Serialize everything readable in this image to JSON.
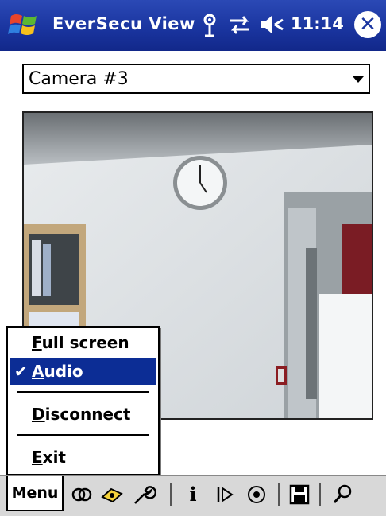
{
  "titlebar": {
    "app_title": "EverSecu View",
    "time": "11:14",
    "icons": [
      "windows-start-icon",
      "signal-antenna-icon",
      "connectivity-icon",
      "volume-icon",
      "close-icon"
    ],
    "close_glyph": "✕"
  },
  "camera_select": {
    "value": "Camera #3"
  },
  "popup_menu": {
    "items": [
      {
        "label": "Full screen",
        "checked": false,
        "selected": false
      },
      {
        "label": "Audio",
        "checked": true,
        "selected": true
      },
      {
        "label": "Disconnect",
        "checked": false,
        "selected": false
      },
      {
        "label": "Exit",
        "checked": false,
        "selected": false
      }
    ],
    "check_glyph": "✔"
  },
  "command_bar": {
    "menu_label": "Menu",
    "info_glyph": "i",
    "icons": [
      "connect-icon",
      "camera-control-icon",
      "settings-icon",
      "info-icon",
      "play-icon",
      "record-icon",
      "save-icon",
      "zoom-icon"
    ]
  },
  "colors": {
    "titlebar": "#1a35a0",
    "menu_highlight": "#0c2d95",
    "command_bar": "#d8d8d8"
  }
}
